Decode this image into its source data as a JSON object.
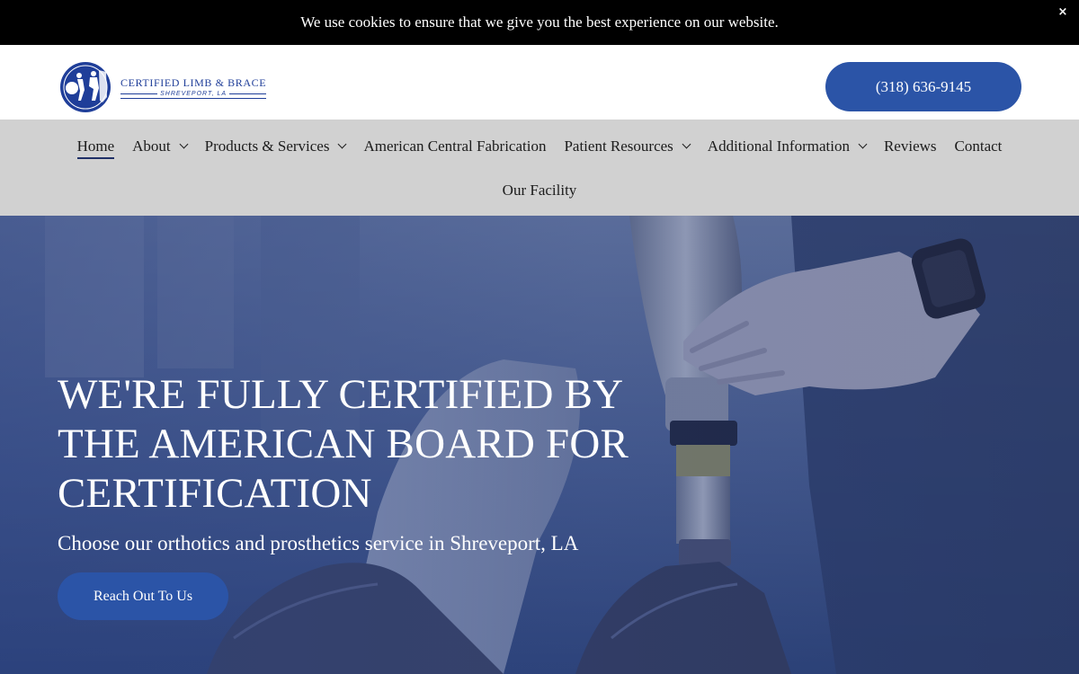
{
  "cookie_bar": {
    "message": "We use cookies to ensure that we give you the best experience on our website.",
    "close_label": "×"
  },
  "header": {
    "logo": {
      "name": "CERTIFIED LIMB & BRACE",
      "location": "SHREVEPORT, LA"
    },
    "phone": "(318) 636-9145"
  },
  "nav": {
    "row1": [
      {
        "label": "Home",
        "active": true,
        "has_dropdown": false
      },
      {
        "label": "About",
        "has_dropdown": true
      },
      {
        "label": "Products & Services",
        "has_dropdown": true
      },
      {
        "label": "American Central Fabrication",
        "has_dropdown": false
      },
      {
        "label": "Patient Resources",
        "has_dropdown": true
      },
      {
        "label": "Additional Information",
        "has_dropdown": true
      },
      {
        "label": "Reviews",
        "has_dropdown": false
      },
      {
        "label": "Contact",
        "has_dropdown": false
      }
    ],
    "row2": [
      {
        "label": "Our Facility",
        "has_dropdown": false
      }
    ]
  },
  "hero": {
    "title_lines": [
      "WE'RE FULLY CERTIFIED BY",
      "THE AMERICAN BOARD FOR",
      "CERTIFICATION"
    ],
    "subtitle": "Choose our orthotics and prosthetics service in Shreveport, LA",
    "cta_label": "Reach Out To Us"
  },
  "colors": {
    "brand_blue": "#2b54a7",
    "logo_blue": "#1f3e99",
    "nav_bg": "#d1d1d1",
    "cookie_bg": "#000000"
  }
}
